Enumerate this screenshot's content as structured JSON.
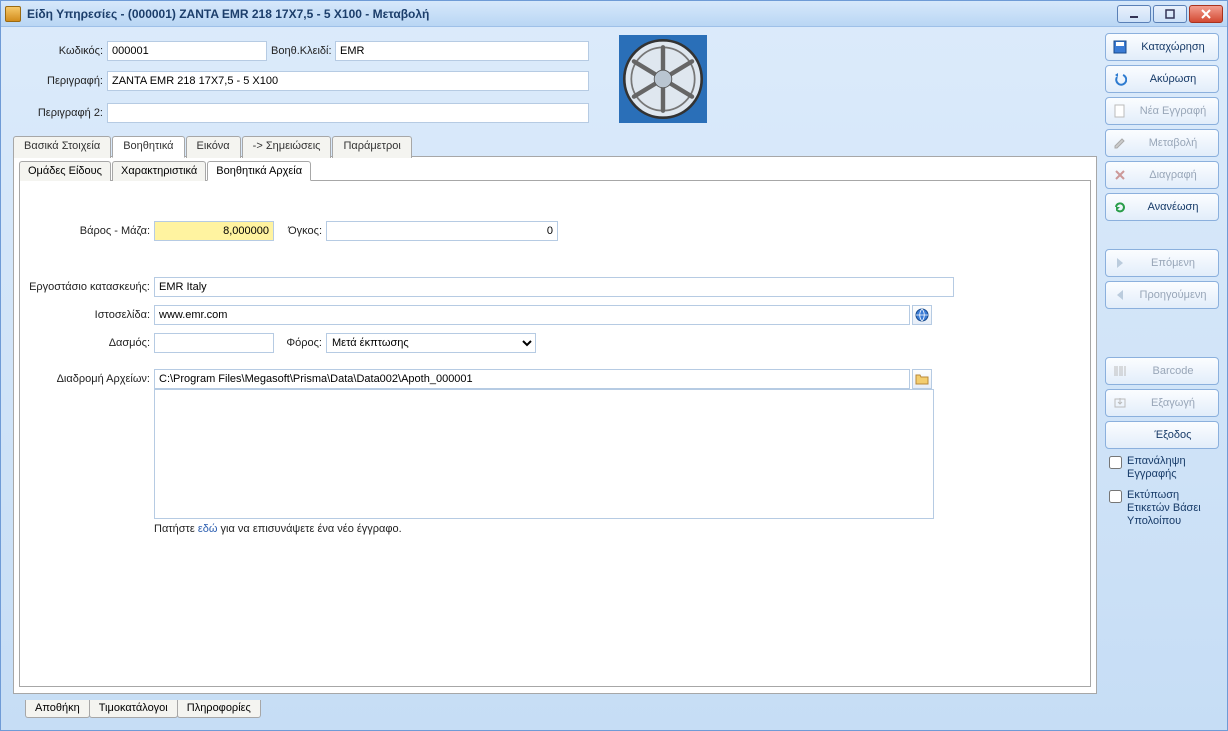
{
  "window": {
    "title": "Είδη Υπηρεσίες - (000001) ZANTA EMR 218 17X7,5 - 5 X100 -  Μεταβολή"
  },
  "header": {
    "code_label": "Κωδικός:",
    "code_value": "000001",
    "auxkey_label": "Βοηθ.Κλειδί:",
    "auxkey_value": "EMR",
    "desc_label": "Περιγραφή:",
    "desc_value": "ZANTA EMR 218 17X7,5 - 5 X100",
    "desc2_label": "Περιγραφή 2:",
    "desc2_value": ""
  },
  "tabs": [
    "Βασικά Στοιχεία",
    "Βοηθητικά",
    "Εικόνα",
    "-> Σημειώσεις",
    "Παράμετροι"
  ],
  "active_tab": 1,
  "subtabs": [
    "Ομάδες Είδους",
    "Χαρακτηριστικά",
    "Βοηθητικά Αρχεία"
  ],
  "active_subtab": 2,
  "form": {
    "weight_label": "Βάρος - Μάζα:",
    "weight_value": "8,000000",
    "volume_label": "Όγκος:",
    "volume_value": "0",
    "factory_label": "Εργοστάσιο κατασκευής:",
    "factory_value": "EMR Italy",
    "website_label": "Ιστοσελίδα:",
    "website_value": "www.emr.com",
    "tariff_label": "Δασμός:",
    "tariff_value": "",
    "tax_label": "Φόρος:",
    "tax_value": "Μετά έκπτωσης",
    "tax_options": [
      "Μετά έκπτωσης"
    ],
    "filepath_label": "Διαδρομή Αρχείων:",
    "filepath_value": "C:\\Program Files\\Megasoft\\Prisma\\Data\\Data002\\Apoth_000001",
    "attach_hint_pre": "Πατήστε ",
    "attach_hint_link": "εδώ",
    "attach_hint_post": "  για να επισυνάψετε ένα νέο έγγραφο."
  },
  "bottom_tabs": [
    "Αποθήκη",
    "Τιμοκατάλογοι",
    "Πληροφορίες"
  ],
  "side_buttons": [
    {
      "key": "save",
      "label": "Καταχώρηση",
      "icon": "save-icon",
      "disabled": false
    },
    {
      "key": "cancel",
      "label": "Ακύρωση",
      "icon": "undo-icon",
      "disabled": false
    },
    {
      "key": "new",
      "label": "Νέα Εγγραφή",
      "icon": "new-icon",
      "disabled": true
    },
    {
      "key": "edit",
      "label": "Μεταβολή",
      "icon": "edit-icon",
      "disabled": true
    },
    {
      "key": "delete",
      "label": "Διαγραφή",
      "icon": "delete-icon",
      "disabled": true
    },
    {
      "key": "refresh",
      "label": "Ανανέωση",
      "icon": "refresh-icon",
      "disabled": false
    },
    {
      "key": "next",
      "label": "Επόμενη",
      "icon": "arrow-right-icon",
      "disabled": true
    },
    {
      "key": "prev",
      "label": "Προηγούμενη",
      "icon": "arrow-left-icon",
      "disabled": true
    },
    {
      "key": "barcode",
      "label": "Barcode",
      "icon": "barcode-icon",
      "disabled": true
    },
    {
      "key": "export",
      "label": "Εξαγωγή",
      "icon": "export-icon",
      "disabled": true
    },
    {
      "key": "exit",
      "label": "Έξοδος",
      "icon": "exit-icon",
      "disabled": false
    }
  ],
  "side_checks": [
    {
      "key": "repeat",
      "label": "Επανάληψη Εγγραφής"
    },
    {
      "key": "print",
      "label": "Εκτύπωση Ετικετών Βάσει Υπολοίπου"
    }
  ]
}
